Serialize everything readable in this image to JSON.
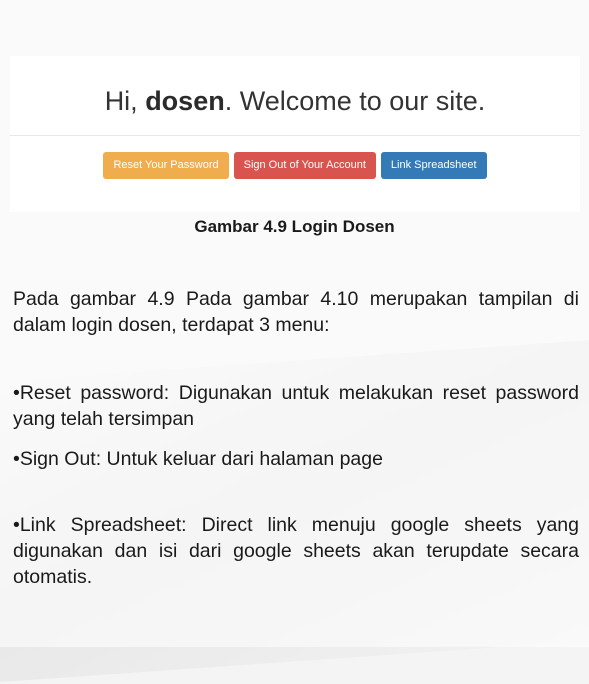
{
  "figure": {
    "greeting_prefix": "Hi, ",
    "username": "dosen",
    "greeting_suffix": ". Welcome to our site.",
    "buttons": {
      "reset": "Reset Your Password",
      "signout": "Sign Out of Your Account",
      "spreadsheet": "Link Spreadsheet"
    },
    "colors": {
      "reset": "#f0ad4e",
      "signout": "#d9534f",
      "spreadsheet": "#337ab7"
    }
  },
  "caption": "Gambar 4.9 Login Dosen",
  "paragraphs": {
    "intro": "Pada gambar 4.9 Pada gambar 4.10 merupakan tampilan di dalam login dosen, terdapat 3 menu:",
    "reset": "•Reset password: Digunakan untuk melakukan reset password yang telah tersimpan",
    "signout": "•Sign Out: Untuk keluar dari halaman page",
    "spreadsheet": "•Link Spreadsheet: Direct link menuju google sheets yang digunakan dan isi dari google sheets akan terupdate secara otomatis."
  }
}
